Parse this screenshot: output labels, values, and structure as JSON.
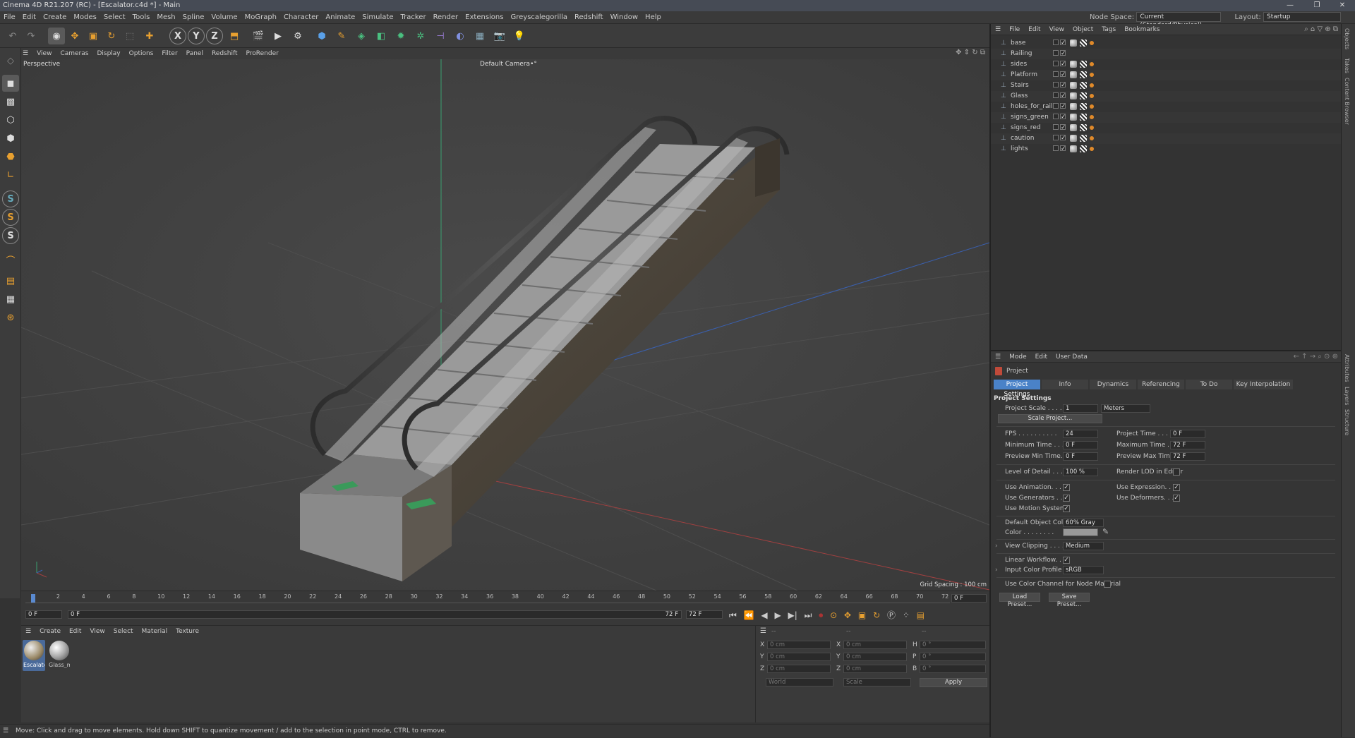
{
  "window": {
    "title": "Cinema 4D R21.207 (RC) - [Escalator.c4d *] - Main"
  },
  "menu": {
    "items": [
      "File",
      "Edit",
      "Create",
      "Modes",
      "Select",
      "Tools",
      "Mesh",
      "Spline",
      "Volume",
      "MoGraph",
      "Character",
      "Animate",
      "Simulate",
      "Tracker",
      "Render",
      "Extensions",
      "Greyscalegorilla",
      "Redshift",
      "Window",
      "Help"
    ],
    "node_space_label": "Node Space:",
    "node_space_value": "Current (Standard/Physical)",
    "layout_label": "Layout:",
    "layout_value": "Startup"
  },
  "toolbar": {
    "axis_x": "X",
    "axis_y": "Y",
    "axis_z": "Z"
  },
  "lefttools": {
    "s1": "S",
    "s2": "S",
    "s3": "S"
  },
  "viewport": {
    "menu": [
      "View",
      "Cameras",
      "Display",
      "Options",
      "Filter",
      "Panel",
      "Redshift",
      "ProRender"
    ],
    "label": "Perspective",
    "camera": "Default Camera",
    "camera_suffix": "•°",
    "grid_spacing": "Grid Spacing : 100 cm"
  },
  "timeline": {
    "ticks": [
      "0",
      "2",
      "4",
      "6",
      "8",
      "10",
      "12",
      "14",
      "16",
      "18",
      "20",
      "22",
      "24",
      "26",
      "28",
      "30",
      "32",
      "34",
      "36",
      "38",
      "40",
      "42",
      "44",
      "46",
      "48",
      "50",
      "52",
      "54",
      "56",
      "58",
      "60",
      "62",
      "64",
      "66",
      "68",
      "70",
      "72"
    ],
    "current_frame_right": "0 F",
    "start": "0 F",
    "preview_start": "0 F",
    "preview_end": "72 F",
    "end": "72 F"
  },
  "materials": {
    "menu": [
      "Create",
      "Edit",
      "View",
      "Select",
      "Material",
      "Texture"
    ],
    "items": [
      {
        "name": "Escalato"
      },
      {
        "name": "Glass_m"
      }
    ]
  },
  "coords": {
    "header_left": "--",
    "header_mid": "--",
    "header_right": "--",
    "rows": [
      {
        "a": "X",
        "av": "0 cm",
        "b": "X",
        "bv": "0 cm",
        "c": "H",
        "cv": "0 °"
      },
      {
        "a": "Y",
        "av": "0 cm",
        "b": "Y",
        "bv": "0 cm",
        "c": "P",
        "cv": "0 °"
      },
      {
        "a": "Z",
        "av": "0 cm",
        "b": "Z",
        "bv": "0 cm",
        "c": "B",
        "cv": "0 °"
      }
    ],
    "mode1": "World",
    "mode2": "Scale",
    "apply": "Apply"
  },
  "status": {
    "text": "Move: Click and drag to move elements. Hold down SHIFT to quantize movement / add to the selection in point mode, CTRL to remove."
  },
  "objects": {
    "menu": [
      "File",
      "Edit",
      "View",
      "Object",
      "Tags",
      "Bookmarks"
    ],
    "rows": [
      "base",
      "Railing",
      "sides",
      "Platform",
      "Stairs",
      "Glass",
      "holes_for_rails",
      "signs_green",
      "signs_red",
      "caution",
      "lights"
    ]
  },
  "side_tabs": [
    "Objects",
    "Takes",
    "Content Browser",
    "Attributes",
    "Layers",
    "Structure"
  ],
  "attributes": {
    "menu": [
      "Mode",
      "Edit",
      "User Data"
    ],
    "header": "Project",
    "tabs": [
      "Project Settings",
      "Info",
      "Dynamics",
      "Referencing",
      "To Do",
      "Key Interpolation"
    ],
    "section": "Project Settings",
    "project_scale_label": "Project Scale . . . . .",
    "project_scale_value": "1",
    "project_scale_unit": "Meters",
    "scale_project_btn": "Scale Project...",
    "fps_label": "FPS . . . . . . . . . .",
    "fps_value": "24",
    "project_time_label": "Project Time . . . . .",
    "project_time_value": "0 F",
    "min_time_label": "Minimum Time . . .",
    "min_time_value": "0 F",
    "max_time_label": "Maximum Time . . .",
    "max_time_value": "72 F",
    "prev_min_label": "Preview Min Time. .",
    "prev_min_value": "0 F",
    "prev_max_label": "Preview Max Time .",
    "prev_max_value": "72 F",
    "lod_label": "Level of Detail . . .",
    "lod_value": "100 %",
    "render_lod_label": "Render LOD in Editor",
    "use_animation_label": "Use Animation. . . .",
    "use_expression_label": "Use Expression. . . .",
    "use_generators_label": "Use Generators . . .",
    "use_deformers_label": "Use Deformers. . . .",
    "use_motion_label": "Use Motion System",
    "default_color_label": "Default Object Color",
    "default_color_value": "60% Gray",
    "color_label": "Color . . . . . . . .",
    "view_clipping_label": "View Clipping . . . .",
    "view_clipping_value": "Medium",
    "linear_workflow_label": "Linear Workflow. . .",
    "input_profile_label": "Input Color Profile .",
    "input_profile_value": "sRGB",
    "node_color_label": "Use Color Channel for Node Material",
    "load_preset": "Load Preset...",
    "save_preset": "Save Preset...",
    "check_mark": "✓"
  },
  "colors": {
    "accent": "#4a82c8",
    "tag_orange": "#e08a2a"
  }
}
